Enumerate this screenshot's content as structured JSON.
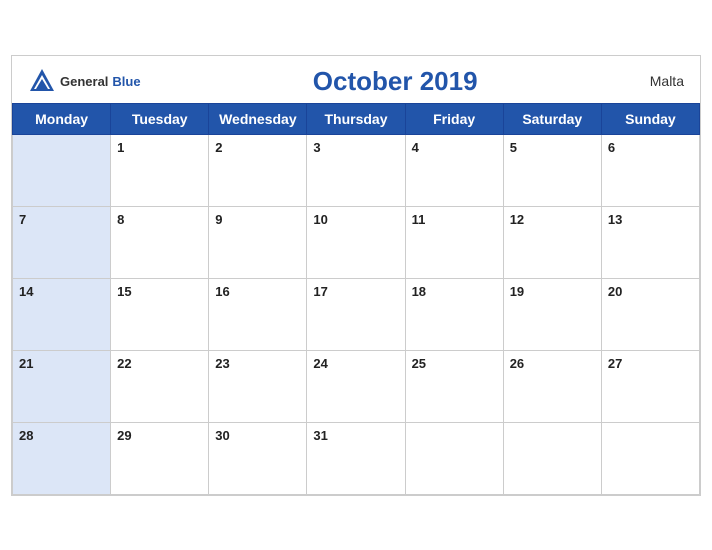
{
  "header": {
    "logo_general": "General",
    "logo_blue": "Blue",
    "title": "October 2019",
    "country": "Malta"
  },
  "days_of_week": [
    "Monday",
    "Tuesday",
    "Wednesday",
    "Thursday",
    "Friday",
    "Saturday",
    "Sunday"
  ],
  "weeks": [
    [
      "",
      "1",
      "2",
      "3",
      "4",
      "5",
      "6"
    ],
    [
      "7",
      "8",
      "9",
      "10",
      "11",
      "12",
      "13"
    ],
    [
      "14",
      "15",
      "16",
      "17",
      "18",
      "19",
      "20"
    ],
    [
      "21",
      "22",
      "23",
      "24",
      "25",
      "26",
      "27"
    ],
    [
      "28",
      "29",
      "30",
      "31",
      "",
      "",
      ""
    ]
  ]
}
